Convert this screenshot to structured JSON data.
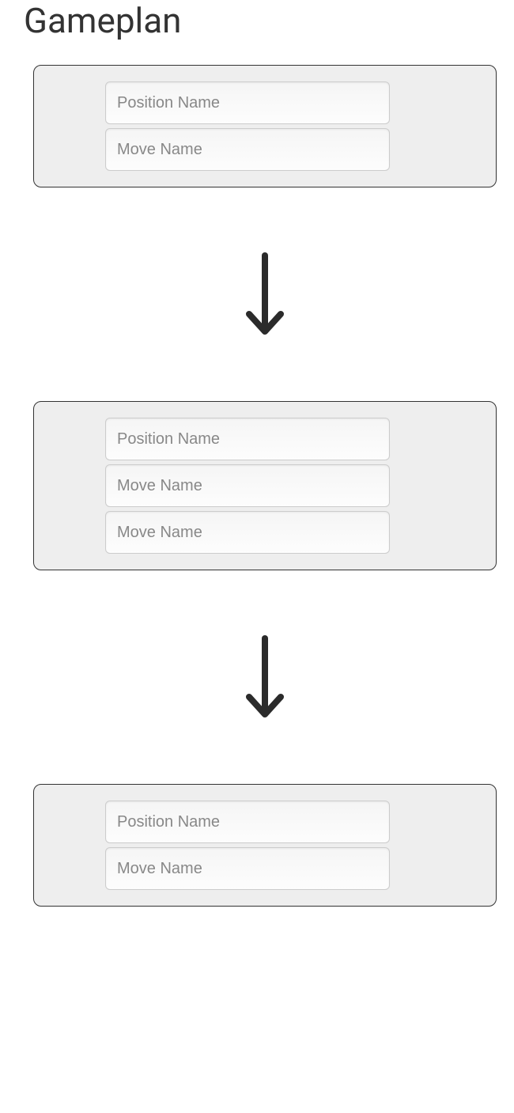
{
  "title": "Gameplan",
  "placeholders": {
    "position": "Position Name",
    "move": "Move Name"
  },
  "cards": [
    {
      "position": "",
      "moves": [
        ""
      ]
    },
    {
      "position": "",
      "moves": [
        "",
        ""
      ]
    },
    {
      "position": "",
      "moves": [
        ""
      ]
    }
  ]
}
